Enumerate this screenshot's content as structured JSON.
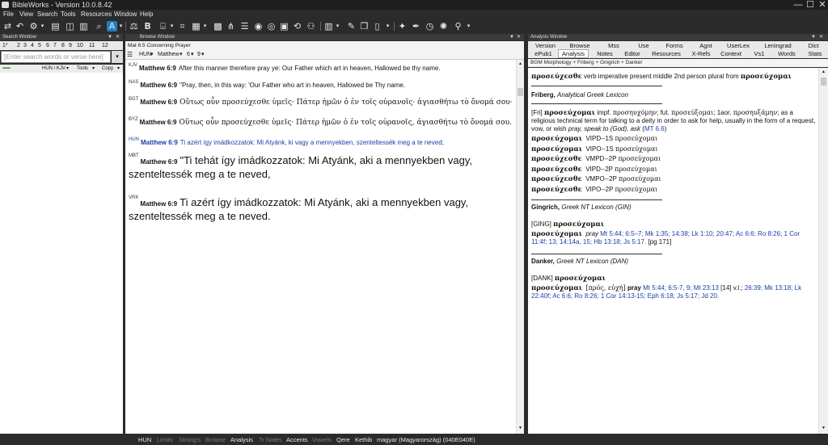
{
  "app": {
    "title": "BibleWorks - Version 10.0.8.42"
  },
  "window_controls": {
    "minimize": "—",
    "maximize": "☐",
    "close": "✕"
  },
  "menu": [
    "File",
    "View",
    "Search",
    "Tools",
    "Resources",
    "Window",
    "Help"
  ],
  "toolbar": {
    "icons": [
      "sync-icon",
      "back-icon",
      "settings-icon",
      "dropdown-icon",
      "book-icon",
      "search-icon",
      "text-icon",
      "dropdown-icon",
      "scales-icon",
      "bold-icon",
      "dropdown-icon",
      "graph-icon",
      "bracket-icon",
      "dropdown-icon",
      "grid-icon",
      "dropdown-icon",
      "tree-icon",
      "list-icon",
      "disc-icon",
      "disc-icon",
      "box-icon",
      "dropdown-icon",
      "undo-icon",
      "people-icon",
      "table-icon",
      "dropdown-icon",
      "notes-icon",
      "dropdown-icon",
      "stack-icon",
      "doc-icon",
      "dropdown-icon",
      "puzzle-icon",
      "pen-icon",
      "clock-icon",
      "wheel-icon",
      "lamp-icon",
      "dropdown-icon"
    ]
  },
  "search_window": {
    "title": "Search Window",
    "tabs": [
      "1*",
      "2",
      "3",
      "4",
      "5",
      "6",
      "7",
      "8",
      "9",
      "10",
      "11",
      "12"
    ],
    "search_placeholder": "[Enter search words or verse here]",
    "side_button": "▾",
    "versions": "HUN / KJV",
    "tools_label": "Tools",
    "copy_label": "Copy",
    "dropdown": "▾"
  },
  "browse_window": {
    "title": "Browse Window",
    "caption": "Mat 6:5 Concerning Prayer",
    "version_select": "HUN",
    "book_select": "Matthew",
    "chapter_select": "6",
    "verse_select": "9",
    "dropdown": "▾",
    "verses": [
      {
        "version": "KJV",
        "ref": "Matthew 6:9",
        "text": "After this manner therefore pray ye: Our Father which art in heaven, Hallowed be thy name."
      },
      {
        "version": "NAS",
        "ref": "Matthew 6:9",
        "text": "\"Pray, then, in this way: 'Our Father who art in heaven, Hallowed be Thy name."
      },
      {
        "version": "BGT",
        "ref": "Matthew 6:9",
        "text": "Οὕτως οὖν προσεύχεσθε ὑμεῖς· Πάτερ ἡμῶν ὁ ἐν τοῖς οὐρανοῖς· ἁγιασθήτω τὸ ὄνομά σου·"
      },
      {
        "version": "BYZ",
        "ref": "Matthew 6:9",
        "text": "Οὕτως οὖν προσεύχεσθε ὑμεῖς· Πάτερ ἡμῶν ὁ ἐν τοῖς οὐρανοῖς, ἁγιασθήτω τὸ ὄνομά σου."
      },
      {
        "version": "HUN",
        "ref": "Matthew 6:9",
        "text": "Ti azért így imádkozzatok: Mi Atyánk, ki vagy a mennyekben, szenteltessék meg a te neved;"
      },
      {
        "version": "MBT",
        "ref": "Matthew 6:9",
        "text": "\"Ti tehát így imádkozzatok: Mi Atyánk, aki a mennyekben vagy, szenteltessék meg a te neved,"
      },
      {
        "version": "VRK",
        "ref": "Matthew 6:9",
        "text": "Ti azért így imádkozzatok: Mi Atyánk, aki a mennyekben vagy, szenteltessék meg a te neved."
      }
    ]
  },
  "analysis_window": {
    "title": "Analysis Window",
    "tabs_row1": [
      "Version",
      "Browse",
      "Mss",
      "Use",
      "Forms",
      "Agnt",
      "UserLex",
      "Leningrad",
      "Dict"
    ],
    "tabs_row2": [
      "ePub1",
      "Analysis",
      "Notes",
      "Editor",
      "Resources",
      "X-Refs",
      "Context",
      "Vs1",
      "Words",
      "Stats"
    ],
    "active_tab": "Analysis",
    "subheader": "BGM Morphology + Friberg + Gingrich + Danker",
    "morph": {
      "word": "προσεύχεσθε",
      "parse": "verb imperative present middle 2nd person plural from",
      "lemma": "προσεύχομαι"
    },
    "friberg": {
      "heading": "Friberg,",
      "title": "Analytical Greek Lexicon",
      "tag": "[Fri]",
      "lemma": "προσεύχομαι",
      "entry_a": "impf.",
      "g1": "προσηυχόμην",
      "entry_b": "; fut.",
      "g2": "προσεύξομαι",
      "entry_c": "; 1aor.",
      "g3": "προσηυξάμην",
      "entry_d": "; as a religious technical term for talking to a deity in order to ask for help, usually in the form of a request, vow, or wish",
      "entry_e": "pray, speak to (God), ask",
      "entry_ref_open": "(",
      "entry_ref": "MT 6.6",
      "entry_ref_close": ")",
      "forms": [
        {
          "form": "προσεύχομαι",
          "parse": "VIPD--1S",
          "lemma": "προσεύχομαι"
        },
        {
          "form": "προσεύχομαι",
          "parse": "VIPO--1S",
          "lemma": "προσεύχομαι"
        },
        {
          "form": "προσεύχεσθε",
          "parse": "VMPD--2P",
          "lemma": "προσεύχομαι"
        },
        {
          "form": "προσεύχεσθε",
          "parse": "VIPD--2P",
          "lemma": "προσεύχομαι"
        },
        {
          "form": "προσεύχεσθε",
          "parse": "VMPO--2P",
          "lemma": "προσεύχομαι"
        },
        {
          "form": "προσεύχεσθε",
          "parse": "VIPO--2P",
          "lemma": "προσεύχομαι"
        }
      ]
    },
    "gingrich": {
      "heading": "Gingrich,",
      "title": "Greek NT Lexicon (GIN)",
      "tag": "[GING]",
      "lemma": "προσεύχομαι",
      "entry_lemma": "προσεύχομαι",
      "gloss": "pray",
      "refs": "Mt 5:44; 6:5–7; Mk 1:35; 14:38; Lk 1:10; 20:47; Ac 6:6; Ro 8:26; 1 Cor 11:4f; 13; 14:14a, 15; Hb 13:18; Js 5:17.",
      "page": "[pg 171]"
    },
    "danker": {
      "heading": "Danker,",
      "title": "Greek NT Lexicon (DAN)",
      "tag": "[DANK]",
      "lemma": "προσεύχομαι",
      "entry_lemma": "προσεύχομαι",
      "etym": "[πρός, εὐχή]",
      "gloss": "pray",
      "refs_a": "Mt 5:44; 6:5-7, 9; Mt 23:13",
      "vl": "[14] v.l.;",
      "refs_b": "26:39; Mk 13:18;",
      "refs_c": "Lk 22:40f; Ac 6:6; Ro 8:26; 1 Cor 14:13-15; Eph 6:18; Js 5:17; Jd 20."
    }
  },
  "status": {
    "items": [
      {
        "label": "HUN",
        "active": true
      },
      {
        "label": "Limits",
        "active": false
      },
      {
        "label": "Strong's",
        "active": false
      },
      {
        "label": "Browse",
        "active": false
      },
      {
        "label": "Analysis",
        "active": true
      },
      {
        "label": "Tr Notes",
        "active": false
      },
      {
        "label": "Accents",
        "active": true
      },
      {
        "label": "Vowels",
        "active": false
      },
      {
        "label": "Qere",
        "active": true
      },
      {
        "label": "Kethib",
        "active": true
      },
      {
        "label": "magyar (Magyarország) (040E040E)",
        "active": true
      }
    ]
  }
}
